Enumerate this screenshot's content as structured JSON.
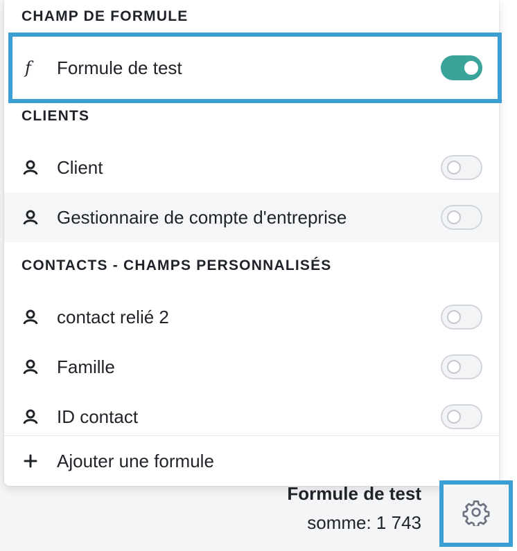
{
  "sections": {
    "formula": {
      "header": "CHAMP DE FORMULE",
      "items": [
        {
          "label": "Formule de test",
          "icon": "function-icon",
          "enabled": true
        }
      ]
    },
    "clients": {
      "header": "CLIENTS",
      "items": [
        {
          "label": "Client",
          "icon": "person-icon",
          "enabled": false
        },
        {
          "label": "Gestionnaire de compte d'entreprise",
          "icon": "person-icon",
          "enabled": false
        }
      ]
    },
    "contacts": {
      "header": "CONTACTS - CHAMPS PERSONNALISÉS",
      "items": [
        {
          "label": "contact relié 2",
          "icon": "person-icon",
          "enabled": false
        },
        {
          "label": "Famille",
          "icon": "person-icon",
          "enabled": false
        },
        {
          "label": "ID contact",
          "icon": "person-icon",
          "enabled": false
        }
      ]
    }
  },
  "footer": {
    "add_formula_label": "Ajouter une formule",
    "icon": "plus-icon"
  },
  "summary": {
    "title": "Formule de test",
    "value": "somme: 1 743"
  },
  "settings": {
    "icon": "gear-icon"
  },
  "colors": {
    "toggle_on": "#3aa49a",
    "highlight": "#3b9fd3"
  }
}
